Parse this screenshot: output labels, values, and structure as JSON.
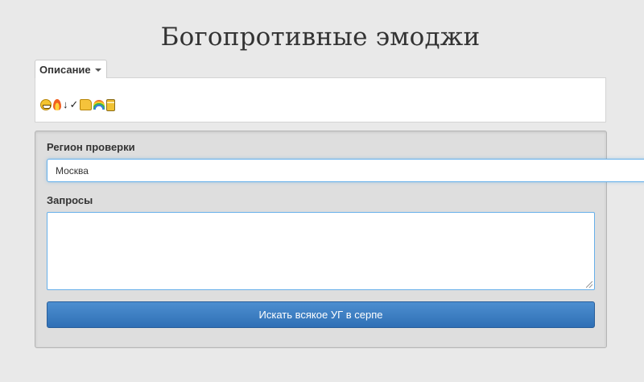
{
  "page": {
    "title": "Богопротивные эмоджи"
  },
  "description": {
    "toggle_label": "Описание",
    "emojis": [
      "grinning-face",
      "fire",
      "↓",
      "✓",
      "thumbs-up",
      "rainbow",
      "honey-jar"
    ]
  },
  "form": {
    "region_label": "Регион проверки",
    "region_value": "Москва",
    "queries_label": "Запросы",
    "queries_value": "",
    "search_button_label": "Искать всякое УГ в серпе"
  },
  "colors": {
    "background": "#e9e9e9",
    "well": "#dedede",
    "button": "#337ab7",
    "focus_border": "#66afe9"
  }
}
